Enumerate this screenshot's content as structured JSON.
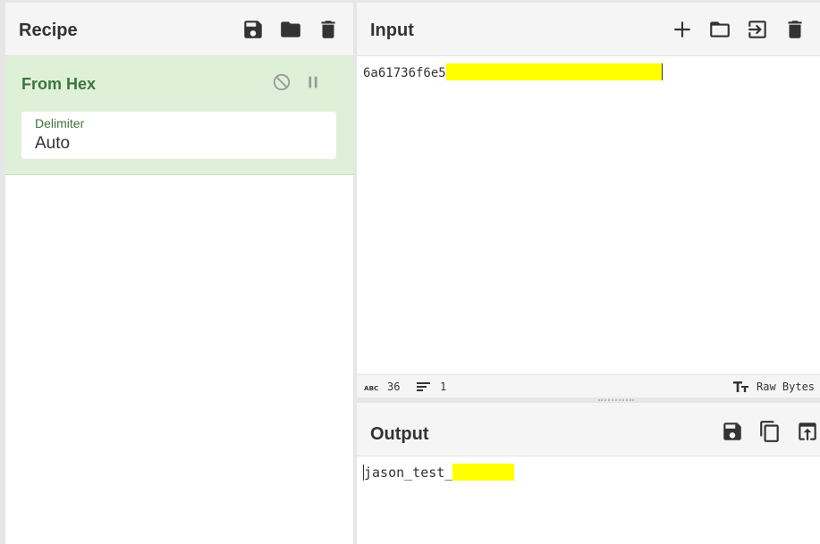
{
  "recipe": {
    "title": "Recipe",
    "icons": [
      "save-icon",
      "folder-icon",
      "trash-icon"
    ],
    "operation": {
      "name": "From Hex",
      "icons": [
        "disable-icon",
        "pause-icon"
      ],
      "field": {
        "label": "Delimiter",
        "value": "Auto"
      }
    }
  },
  "input": {
    "title": "Input",
    "icons": [
      "plus-icon",
      "folder-icon",
      "import-icon",
      "trash-icon"
    ],
    "text": "6a61736f6e5",
    "status": {
      "chars": "36",
      "lines": "1",
      "encoding": "Raw Bytes"
    }
  },
  "output": {
    "title": "Output",
    "icons": [
      "save-icon",
      "copy-icon",
      "open-in-input-icon"
    ],
    "text": "jason_test_"
  },
  "colors": {
    "highlight": "#ffff00",
    "op_bg": "#dff0d8",
    "op_text": "#3c763d"
  }
}
